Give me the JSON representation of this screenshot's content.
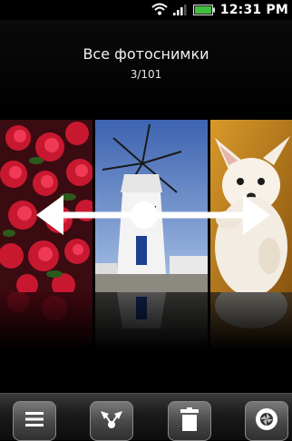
{
  "status_bar": {
    "time": "12:31 PM",
    "icons": [
      "wifi-icon",
      "signal-icon",
      "battery-icon"
    ]
  },
  "album": {
    "title": "Все фотоснимки",
    "counter": "3/101"
  },
  "photos": [
    {
      "name": "red-flowers-photo"
    },
    {
      "name": "windmill-photo"
    },
    {
      "name": "puppy-photo"
    }
  ],
  "toolbar": {
    "buttons": [
      "menu-icon",
      "share-icon",
      "trash-icon",
      "camera-icon"
    ]
  },
  "colors": {
    "background": "#000000",
    "toolbar_button": "#5a5a5a",
    "battery": "#3fbf3f"
  }
}
